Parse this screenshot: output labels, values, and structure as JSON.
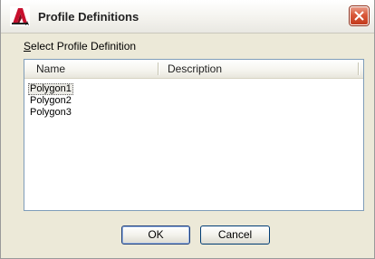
{
  "window": {
    "title": "Profile Definitions",
    "icon": "autocad-app-icon",
    "close_icon": "close-icon"
  },
  "section": {
    "label_accel": "S",
    "label_rest": "elect Profile Definition"
  },
  "list": {
    "columns": [
      "Name",
      "Description"
    ],
    "rows": [
      {
        "name": "Polygon1",
        "description": "",
        "selected": true
      },
      {
        "name": "Polygon2",
        "description": "",
        "selected": false
      },
      {
        "name": "Polygon3",
        "description": "",
        "selected": false
      }
    ]
  },
  "buttons": {
    "ok": "OK",
    "cancel": "Cancel"
  },
  "colors": {
    "close_button": "#d9583a",
    "list_border": "#7f9db9",
    "button_border": "#1c3c78"
  }
}
